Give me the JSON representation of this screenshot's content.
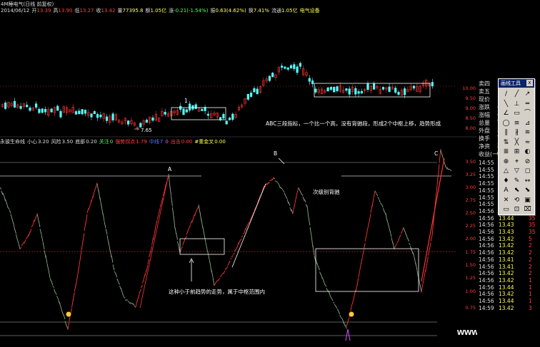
{
  "header": {
    "title": "4M睡电气(日线 前复权)",
    "date": "2014/06/12",
    "open_label": "开",
    "open": "13.39",
    "high_label": "高",
    "high": "13.90",
    "low_label": "低",
    "low": "13.27",
    "close_label": "收",
    "close": "13.42",
    "vol_label": "量",
    "vol": "77395.8",
    "amt_label": "额",
    "amt": "1.05亿",
    "chg_label": "涨",
    "chg": "-0.21(-1.54%)",
    "amp_label": "振",
    "amp": "0.63(4.62%)",
    "turnover_label": "换",
    "turnover": "7.41%",
    "float_label": "流通",
    "float": "1.05亿",
    "industry": "电气设备"
  },
  "indicator_header": {
    "name": "永骏生命线",
    "p1_label": "小心",
    "p1": "3.20",
    "p2_label": "风险",
    "p2": "3.50",
    "p3_label": "底部",
    "p3": "0.20",
    "p4_label": "关注",
    "p4": "0",
    "p5_label": "强势拐点",
    "p5": "1.79",
    "p6_label": "中线",
    "p6": "7",
    "p7": "0",
    "p8_label": "出击",
    "p8": "0.00",
    "p9_label": "#重金叉",
    "p9": "0.00"
  },
  "annotations": {
    "abc_text": "ABC三段指标，一个比一个高，没有背驰段，形成2个中枢上移，趋势形成",
    "low_price": "7.65",
    "marker_1": "1",
    "marker_a": "A",
    "marker_b": "B",
    "marker_c": "C",
    "sub_divergence": "次级别背驰",
    "small_trend": "这种小于前趋势的走势，属于中枢范围内"
  },
  "price_axis": [
    "10.00",
    "9.50",
    "9.00",
    "8.50",
    "8.00"
  ],
  "indicator_axis": [
    "3.50",
    "3.25",
    "3.00",
    "2.75",
    "2.50",
    "2.25",
    "2.00",
    "1.75",
    "1.50",
    "1.25",
    "1.00",
    "0.75"
  ],
  "quote_panel": [
    {
      "label": "卖四",
      "value": "13.5"
    },
    {
      "label": "卖五",
      "value": "13.5"
    },
    {
      "label": "现价",
      "value": "13.4"
    },
    {
      "label": "涨跌",
      "value": "-0.2"
    },
    {
      "label": "涨幅",
      "value": "-1.54"
    },
    {
      "label": "总量",
      "value": "7739"
    },
    {
      "label": "外盘",
      "value": "3158"
    },
    {
      "label": "换手",
      "value": "7.41"
    },
    {
      "label": "净资",
      "value": "3.10"
    },
    {
      "label": "收益(一)",
      "value": "0.0"
    }
  ],
  "ticks": [
    {
      "time": "14:55",
      "price": "13.44",
      "vol": "8"
    },
    {
      "time": "14:55",
      "price": "13.44",
      "vol": "1"
    },
    {
      "time": "14:55",
      "price": "13.42",
      "vol": "1"
    },
    {
      "time": "14:55",
      "price": "13.44",
      "vol": "4"
    },
    {
      "time": "14:55",
      "price": "13.43",
      "vol": "4"
    },
    {
      "time": "14:55",
      "price": "13.43",
      "vol": "3"
    },
    {
      "time": "14:55",
      "price": "13.43",
      "vol": "2"
    },
    {
      "time": "14:56",
      "price": "13.43",
      "vol": "4"
    },
    {
      "time": "14:56",
      "price": "13.44",
      "vol": "35"
    },
    {
      "time": "14:56",
      "price": "13.43",
      "vol": "35"
    },
    {
      "time": "14:56",
      "price": "13.43",
      "vol": "35"
    },
    {
      "time": "14:56",
      "price": "13.42",
      "vol": "5"
    },
    {
      "time": "14:56",
      "price": "13.42",
      "vol": "2"
    },
    {
      "time": "14:56",
      "price": "13.42",
      "vol": "2"
    },
    {
      "time": "14:56",
      "price": "13.41",
      "vol": "2"
    },
    {
      "time": "14:56",
      "price": "13.41",
      "vol": "2"
    },
    {
      "time": "14:56",
      "price": "13.42",
      "vol": "2"
    },
    {
      "time": "14:56",
      "price": "13.42",
      "vol": "1"
    },
    {
      "time": "14:56",
      "price": "13.44",
      "vol": "1"
    },
    {
      "time": "14:56",
      "price": "13.42",
      "vol": "1"
    },
    {
      "time": "14:56",
      "price": "13.44",
      "vol": "1"
    },
    {
      "time": "14:59",
      "price": "13.42",
      "vol": "3"
    }
  ],
  "toolbox": {
    "title": "画线工具",
    "close": "x",
    "tools": [
      "/",
      "╱",
      "↗",
      "╲",
      "⊥",
      "═",
      "∠",
      "▭",
      "⌒",
      "◯",
      "≡",
      "⊿",
      "∥",
      "∦",
      "≋",
      "⇅",
      "╳",
      "≈",
      "≣",
      "⊞",
      "◐",
      "⊕",
      "⌖",
      "⊘",
      "△",
      "▽",
      "◻",
      "♦",
      "✎",
      "↔",
      "A",
      "⬉",
      "⬊",
      "✕",
      "⟲",
      "▣",
      "▭",
      "⊡",
      "⌧"
    ]
  },
  "watermark": "www.7gpzb.com",
  "colors": {
    "up": "#ff3333",
    "down": "#55ffff",
    "level": "#ff4040",
    "box": "#ffffff"
  }
}
